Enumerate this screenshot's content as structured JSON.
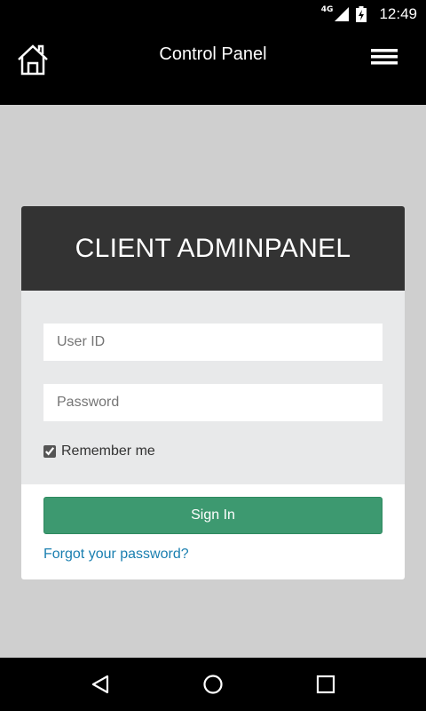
{
  "status_bar": {
    "network": "4G",
    "time": "12:49",
    "icons": [
      "signal-icon",
      "battery-charging-icon"
    ]
  },
  "app_bar": {
    "title": "Control Panel",
    "icons": [
      "home-icon",
      "menu-icon"
    ]
  },
  "login_card": {
    "header": "CLIENT ADMINPANEL",
    "user_id_placeholder": "User ID",
    "password_placeholder": "Password",
    "remember_label": "Remember me",
    "remember_checked": true,
    "signin_label": "Sign In",
    "forgot_label": "Forgot your password?"
  },
  "colors": {
    "card_header": "#333333",
    "signin_button": "#3d9970",
    "link": "#1a7fb0",
    "background": "#cfcfcf"
  },
  "nav_bar": {
    "icons": [
      "back-icon",
      "home-circle-icon",
      "recents-icon"
    ]
  }
}
